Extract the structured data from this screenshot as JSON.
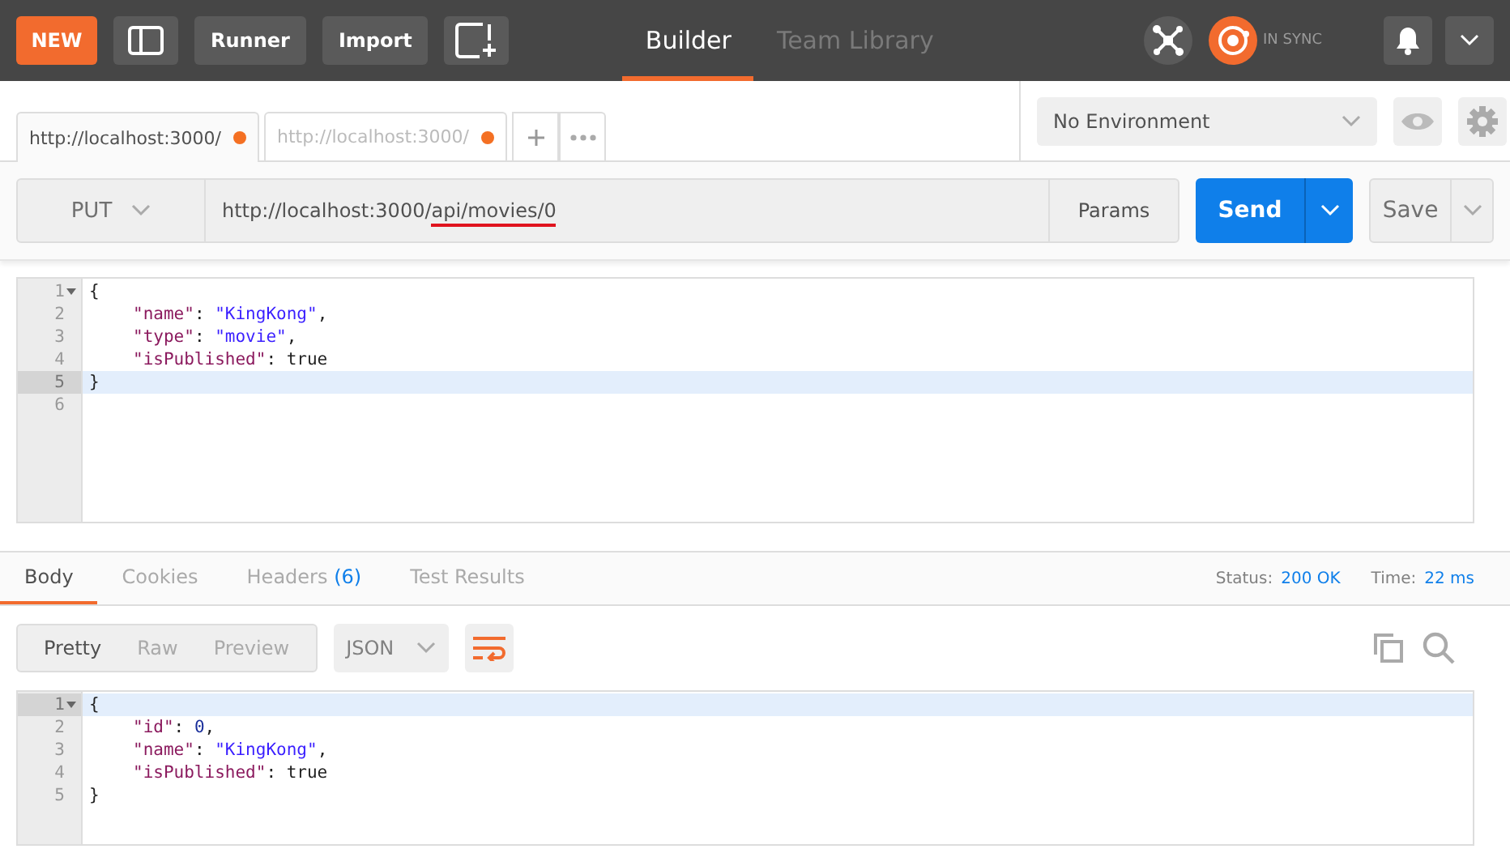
{
  "header": {
    "new_button": "NEW",
    "buttons": [
      "Runner",
      "Import"
    ],
    "nav_tabs": [
      {
        "label": "Builder",
        "selected": true
      },
      {
        "label": "Team Library",
        "selected": false
      }
    ],
    "sync_status": "IN SYNC"
  },
  "request_tabs": [
    {
      "label": "http://localhost:3000/",
      "selected": true,
      "unsaved": true
    },
    {
      "label": "http://localhost:3000/",
      "selected": false,
      "unsaved": true
    }
  ],
  "environment": "No Environment",
  "request": {
    "method": "PUT",
    "url_parts": [
      {
        "text": "http://localhost:3000/",
        "underlined": false
      },
      {
        "text": "api/movies/0",
        "underlined": true
      }
    ],
    "params_button": "Params",
    "send_button": "Send",
    "save_button": "Save"
  },
  "request_body": [
    {
      "number": "1",
      "foldable": true,
      "active": false,
      "indented": false,
      "tokens": [
        {
          "kind": "punct",
          "text": "{"
        }
      ]
    },
    {
      "number": "2",
      "foldable": false,
      "active": false,
      "indented": true,
      "tokens": [
        {
          "kind": "key",
          "text": "\"name\""
        },
        {
          "kind": "punct",
          "text": ": "
        },
        {
          "kind": "string",
          "text": "\"KingKong\""
        },
        {
          "kind": "punct",
          "text": ","
        }
      ]
    },
    {
      "number": "3",
      "foldable": false,
      "active": false,
      "indented": true,
      "tokens": [
        {
          "kind": "key",
          "text": "\"type\""
        },
        {
          "kind": "punct",
          "text": ": "
        },
        {
          "kind": "string",
          "text": "\"movie\""
        },
        {
          "kind": "punct",
          "text": ","
        }
      ]
    },
    {
      "number": "4",
      "foldable": false,
      "active": false,
      "indented": true,
      "tokens": [
        {
          "kind": "key",
          "text": "\"isPublished\""
        },
        {
          "kind": "punct",
          "text": ": "
        },
        {
          "kind": "bool",
          "text": "true"
        }
      ]
    },
    {
      "number": "5",
      "foldable": false,
      "active": true,
      "indented": false,
      "tokens": [
        {
          "kind": "punct",
          "text": "}"
        }
      ]
    },
    {
      "number": "6",
      "foldable": false,
      "active": false
    }
  ],
  "response_tabs": [
    {
      "label": "Body",
      "selected": true
    },
    {
      "label": "Cookies",
      "selected": false
    },
    {
      "label": "Headers",
      "count": "(6)",
      "selected": false
    },
    {
      "label": "Test Results",
      "selected": false
    }
  ],
  "response_status": {
    "status_label": "Status:",
    "status": "200 OK",
    "time_label": "Time:",
    "time": "22 ms"
  },
  "view_modes": [
    {
      "label": "Pretty",
      "selected": true
    },
    {
      "label": "Raw",
      "selected": false
    },
    {
      "label": "Preview",
      "selected": false
    }
  ],
  "language": "JSON",
  "wrap_lines": true,
  "response_body": [
    {
      "number": "1",
      "foldable": true,
      "active": true,
      "indented": false,
      "tokens": [
        {
          "kind": "punct",
          "text": "{"
        }
      ]
    },
    {
      "number": "2",
      "foldable": false,
      "active": false,
      "indented": true,
      "tokens": [
        {
          "kind": "key",
          "text": "\"id\""
        },
        {
          "kind": "punct",
          "text": ": "
        },
        {
          "kind": "number",
          "text": "0"
        },
        {
          "kind": "punct",
          "text": ","
        }
      ]
    },
    {
      "number": "3",
      "foldable": false,
      "active": false,
      "indented": true,
      "tokens": [
        {
          "kind": "key",
          "text": "\"name\""
        },
        {
          "kind": "punct",
          "text": ": "
        },
        {
          "kind": "string",
          "text": "\"KingKong\""
        },
        {
          "kind": "punct",
          "text": ","
        }
      ]
    },
    {
      "number": "4",
      "foldable": false,
      "active": false,
      "indented": true,
      "tokens": [
        {
          "kind": "key",
          "text": "\"isPublished\""
        },
        {
          "kind": "punct",
          "text": ": "
        },
        {
          "kind": "bool",
          "text": "true"
        }
      ]
    },
    {
      "number": "5",
      "foldable": false,
      "active": false,
      "indented": false,
      "tokens": [
        {
          "kind": "punct",
          "text": "}"
        }
      ]
    }
  ]
}
